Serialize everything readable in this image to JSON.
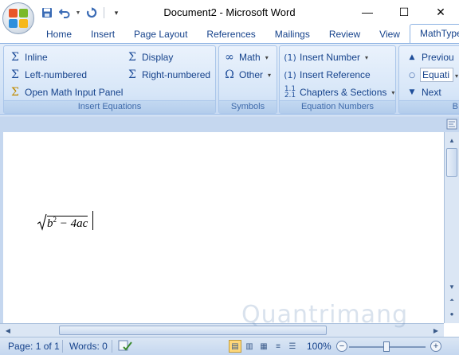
{
  "window": {
    "title": "Document2 - Microsoft Word",
    "minimize": "—",
    "maximize": "☐",
    "close": "✕"
  },
  "qat": {
    "save_icon": "save-icon",
    "undo_icon": "undo-icon",
    "redo_icon": "redo-icon",
    "customize_icon": "chevron-down-icon"
  },
  "tabs": [
    {
      "label": "Home"
    },
    {
      "label": "Insert"
    },
    {
      "label": "Page Layout"
    },
    {
      "label": "References"
    },
    {
      "label": "Mailings"
    },
    {
      "label": "Review"
    },
    {
      "label": "View"
    },
    {
      "label": "MathType"
    }
  ],
  "ribbon": {
    "insert_equations": {
      "label": "Insert Equations",
      "inline": "Inline",
      "display": "Display",
      "left_numbered": "Left-numbered",
      "right_numbered": "Right-numbered",
      "open_math_input_panel": "Open Math Input Panel"
    },
    "symbols": {
      "label": "Symbols",
      "math": "Math",
      "other": "Other"
    },
    "equation_numbers": {
      "label": "Equation Numbers",
      "insert_number": "Insert Number",
      "insert_reference": "Insert Reference",
      "chapters_sections": "Chapters & Sections"
    },
    "browse": {
      "label": "B",
      "previous": "Previou",
      "equation": "Equati",
      "next": "Next"
    }
  },
  "document": {
    "radicand_b": "b",
    "exponent": "2",
    "rest": " − 4ac"
  },
  "status": {
    "page": "Page: 1 of 1",
    "words": "Words: 0",
    "zoom": "100%",
    "zoom_level_percent": 100
  },
  "colors": {
    "ribbon": "#d3e3f6",
    "accent": "#15428b",
    "status_bar": "#c5d7ef"
  },
  "watermark": "Quantrimang"
}
